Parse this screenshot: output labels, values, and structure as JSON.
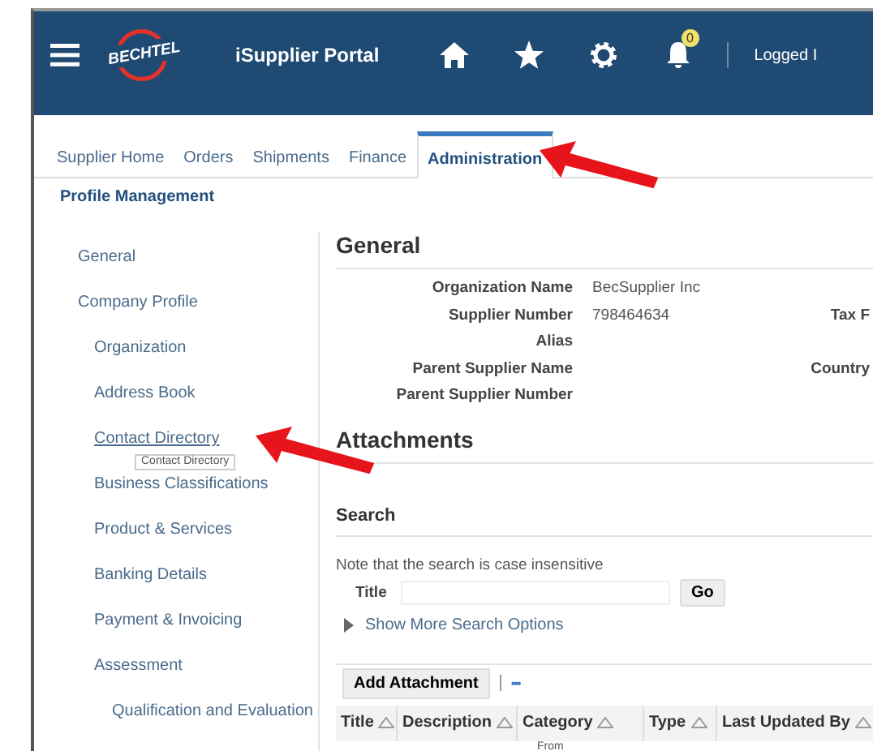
{
  "header": {
    "logo_text": "BECHTEL",
    "app_title": "iSupplier Portal",
    "notification_count": "0",
    "user_text": "Logged I"
  },
  "tabs": [
    {
      "label": "Supplier Home",
      "selected": false
    },
    {
      "label": "Orders",
      "selected": false
    },
    {
      "label": "Shipments",
      "selected": false
    },
    {
      "label": "Finance",
      "selected": false
    },
    {
      "label": "Administration",
      "selected": true
    }
  ],
  "subtab": "Profile Management",
  "sidebar": {
    "items": [
      {
        "label": "General",
        "hovered": false
      },
      {
        "label": "Company Profile",
        "hovered": false,
        "children": [
          {
            "label": "Organization",
            "hovered": false
          },
          {
            "label": "Address Book",
            "hovered": false
          },
          {
            "label": "Contact Directory",
            "hovered": true
          },
          {
            "label": "Business Classifications",
            "hovered": false
          },
          {
            "label": "Product & Services",
            "hovered": false
          },
          {
            "label": "Banking Details",
            "hovered": false
          },
          {
            "label": "Payment & Invoicing",
            "hovered": false
          },
          {
            "label": "Assessment",
            "hovered": false,
            "children": [
              {
                "label": "Qualification and Evaluation",
                "hovered": false
              }
            ]
          }
        ]
      }
    ]
  },
  "tooltip": "Contact Directory",
  "general": {
    "heading": "General",
    "fields": [
      {
        "label": "Organization Name",
        "value": "BecSupplier Inc"
      },
      {
        "label": "Supplier Number",
        "value": "798464634",
        "side_label": "Tax F"
      },
      {
        "label": "Alias"
      },
      {
        "label": "Parent Supplier Name",
        "side_label": "Country"
      },
      {
        "label": "Parent Supplier Number"
      }
    ]
  },
  "attachments": {
    "heading": "Attachments",
    "search_heading": "Search",
    "note": "Note that the search is case insensitive",
    "title_label": "Title",
    "go_button": "Go",
    "more_options": "Show More Search Options",
    "add_button": "Add Attachment",
    "more_button": "•••",
    "columns": [
      "Title",
      "Description",
      "Category",
      "Type",
      "Last Updated By"
    ],
    "rows": [
      {
        "category": "From"
      }
    ]
  }
}
